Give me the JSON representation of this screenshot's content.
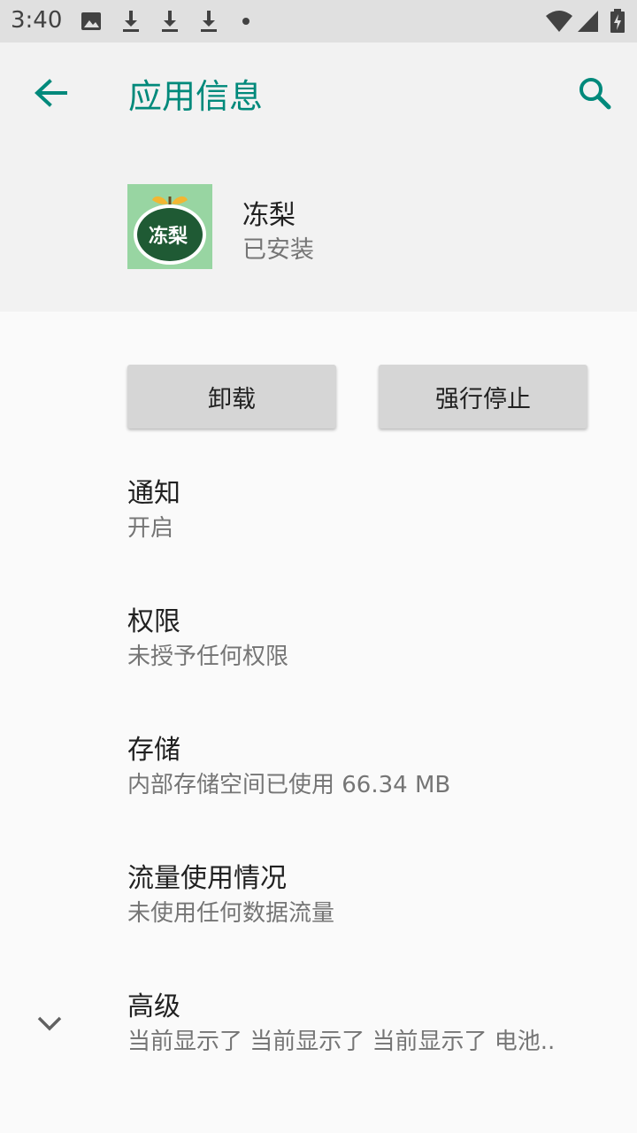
{
  "status_bar": {
    "time": "3:40"
  },
  "app_bar": {
    "title": "应用信息"
  },
  "app": {
    "name": "冻梨",
    "status": "已安装",
    "icon_text": "冻梨",
    "icon_bg": "#98d5a2"
  },
  "buttons": {
    "uninstall": "卸载",
    "force_stop": "强行停止"
  },
  "items": [
    {
      "title": "通知",
      "summary": "开启"
    },
    {
      "title": "权限",
      "summary": "未授予任何权限"
    },
    {
      "title": "存储",
      "summary": "内部存储空间已使用 66.34 MB"
    },
    {
      "title": "流量使用情况",
      "summary": "未使用任何数据流量"
    },
    {
      "title": "高级",
      "summary": "当前显示了 当前显示了 当前显示了 电池.."
    }
  ],
  "colors": {
    "accent": "#00897b",
    "status_bar": "#e0e0e0",
    "header_bg": "#f2f2f2"
  }
}
